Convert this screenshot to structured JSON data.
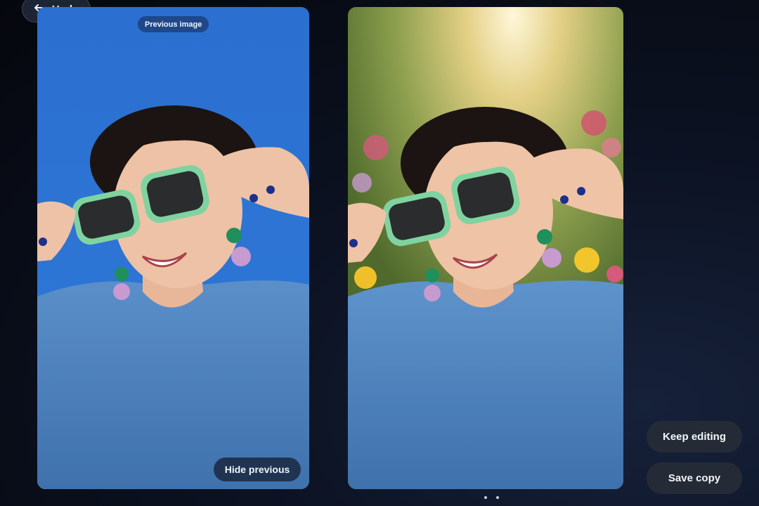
{
  "toolbar": {
    "undo_label": "Undo",
    "undo_icon": "undo-arrow-icon"
  },
  "comparison": {
    "previous_label": "Previous image",
    "hide_previous_label": "Hide previous",
    "previous_background": "#2d74d2",
    "edited_background": "garden with flowers"
  },
  "actions": {
    "keep_editing_label": "Keep editing",
    "save_copy_label": "Save copy"
  },
  "pager": {
    "pages": 2,
    "current": 1
  },
  "colors": {
    "page_background": "#0c1222",
    "button_background": "#252b36",
    "sky_blue": "#2d74d2",
    "shirt_blue": "#4f84bf",
    "sunglasses_green": "#7fd3a0"
  }
}
